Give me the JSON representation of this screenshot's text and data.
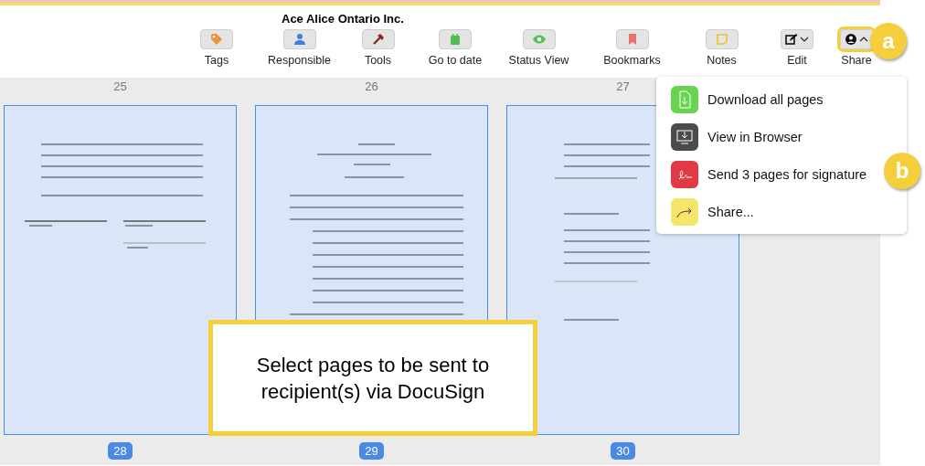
{
  "window": {
    "title": "Ace Alice Ontario Inc."
  },
  "toolbar": [
    {
      "label": "Tags",
      "highlighted": false
    },
    {
      "label": "Responsible",
      "highlighted": false
    },
    {
      "label": "Tools",
      "highlighted": false
    },
    {
      "label": "Go to date",
      "highlighted": false
    },
    {
      "label": "Status View",
      "highlighted": false
    },
    {
      "label": "Bookmarks",
      "highlighted": false
    },
    {
      "label": "Notes",
      "highlighted": false
    },
    {
      "label": "Edit",
      "expanded": false,
      "highlighted": false
    },
    {
      "label": "Share",
      "expanded": true,
      "highlighted": true
    }
  ],
  "previous_row_labels": [
    "25",
    "26",
    "27"
  ],
  "pages": [
    {
      "number": "28",
      "selected": true
    },
    {
      "number": "29",
      "selected": true
    },
    {
      "number": "30",
      "selected": true
    }
  ],
  "share_menu": [
    {
      "label": "Download all pages"
    },
    {
      "label": "View in Browser"
    },
    {
      "label": "Send 3 pages for signature"
    },
    {
      "label": "Share..."
    }
  ],
  "callout": {
    "text": "Select pages to be sent to recipient(s) via DocuSign"
  },
  "markers": [
    {
      "label": "a"
    },
    {
      "label": "b"
    }
  ]
}
